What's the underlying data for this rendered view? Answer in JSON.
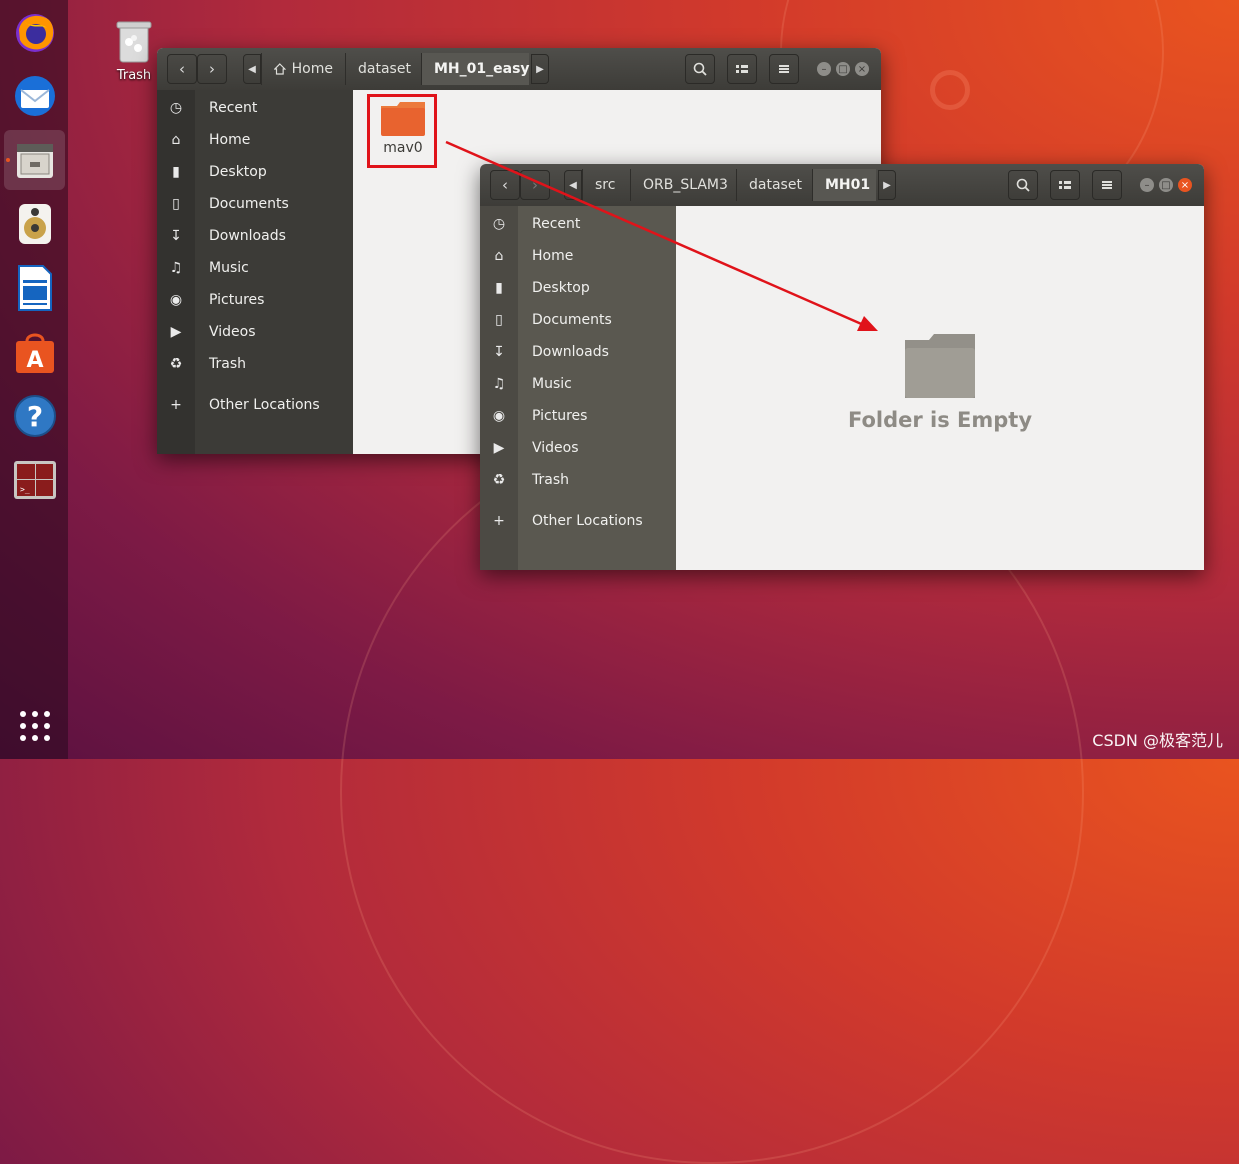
{
  "desktop": {
    "trash_label": "Trash",
    "watermark": "CSDN @极客范儿"
  },
  "dock": {
    "items": [
      "firefox-icon",
      "thunderbird-icon",
      "files-icon",
      "rhythmbox-icon",
      "writer-icon",
      "software-icon",
      "help-icon",
      "terminal-icon"
    ]
  },
  "window1": {
    "breadcrumbs": [
      "Home",
      "dataset",
      "MH_01_easy"
    ],
    "sidebar": [
      "Recent",
      "Home",
      "Desktop",
      "Documents",
      "Downloads",
      "Music",
      "Pictures",
      "Videos",
      "Trash",
      "Other Locations"
    ],
    "folder_name": "mav0"
  },
  "window2": {
    "breadcrumbs": [
      "src",
      "ORB_SLAM3",
      "dataset",
      "MH01"
    ],
    "sidebar": [
      "Recent",
      "Home",
      "Desktop",
      "Documents",
      "Downloads",
      "Music",
      "Pictures",
      "Videos",
      "Trash",
      "Other Locations"
    ],
    "empty_text": "Folder is Empty"
  },
  "colors": {
    "accent": "#e95420",
    "annotation": "#e0131a"
  }
}
